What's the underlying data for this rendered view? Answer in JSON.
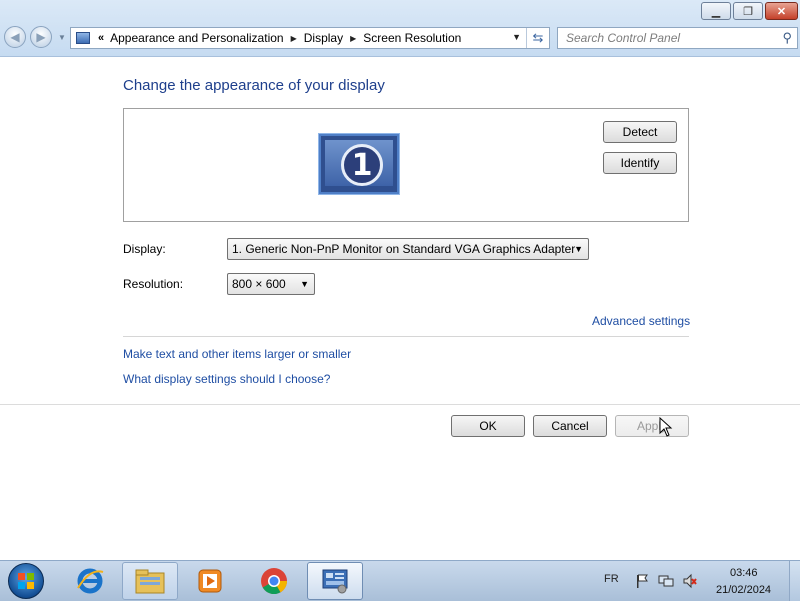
{
  "window": {
    "minimize_icon": "minimize-icon",
    "maximize_icon": "restore-icon",
    "close_icon": "close-icon"
  },
  "nav": {
    "breadcrumb_prefix": "«",
    "breadcrumbs": [
      "Appearance and Personalization",
      "Display",
      "Screen Resolution"
    ],
    "search_placeholder": "Search Control Panel"
  },
  "main": {
    "title": "Change the appearance of your display",
    "monitor_number": "1",
    "detect_label": "Detect",
    "identify_label": "Identify",
    "display_label": "Display:",
    "display_value": "1. Generic Non-PnP Monitor on Standard VGA Graphics Adapter",
    "resolution_label": "Resolution:",
    "resolution_value": "800 × 600",
    "advanced_link": "Advanced settings",
    "text_size_link": "Make text and other items larger or smaller",
    "help_link": "What display settings should I choose?"
  },
  "footer": {
    "ok_label": "OK",
    "cancel_label": "Cancel",
    "apply_label": "Apply"
  },
  "taskbar": {
    "apps": [
      "internet-explorer-icon",
      "file-explorer-icon",
      "media-player-icon",
      "chrome-icon",
      "control-panel-icon"
    ],
    "language": "FR",
    "time": "03:46",
    "date": "21/02/2024"
  },
  "colors": {
    "title_blue": "#1e3f8c",
    "link_blue": "#1f4ea3",
    "taskbar": "#b8cbe2"
  }
}
